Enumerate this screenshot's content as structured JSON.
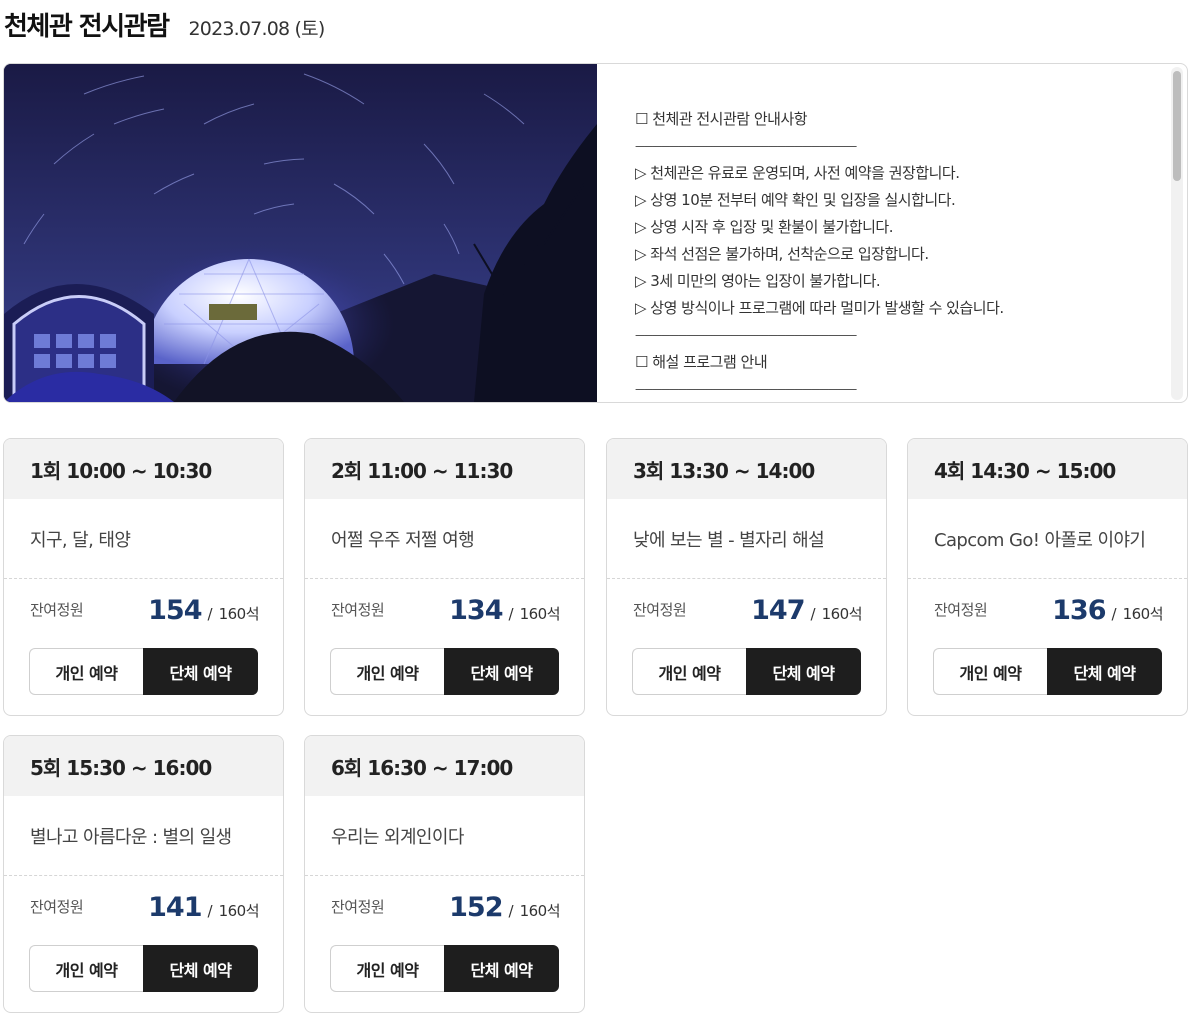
{
  "header": {
    "title": "천체관 전시관람",
    "date": "2023.07.08 (토)"
  },
  "hero": {
    "photo_alt": "천체관",
    "notice_lines": [
      "☐ 천체관 전시관람 안내사항",
      "------------------------------------------------------------------------------",
      "▷ 천체관은 유료로 운영되며, 사전 예약을 권장합니다.",
      "▷ 상영 10분 전부터 예약 확인 및 입장을 실시합니다.",
      "▷ 상영 시작 후 입장 및 환불이 불가합니다.",
      "▷ 좌석 선점은 불가하며, 선착순으로 입장합니다.",
      "▷ 3세 미만의 영아는 입장이 불가합니다.",
      "▷ 상영 방식이나 프로그램에 따라 멀미가 발생할 수 있습니다.",
      "------------------------------------------------------------------------------",
      "☐ 해설 프로그램 안내",
      "------------------------------------------------------------------------------"
    ]
  },
  "sessions": [
    {
      "title": "1회 10:00 ~ 10:30",
      "program": "지구, 달, 태양",
      "seats_label": "잔여정원",
      "remaining": "154",
      "slash": "/",
      "total": "160석",
      "individual_label": "개인 예약",
      "group_label": "단체 예약"
    },
    {
      "title": "2회 11:00 ~ 11:30",
      "program": "어쩔 우주 저쩔 여행",
      "seats_label": "잔여정원",
      "remaining": "134",
      "slash": "/",
      "total": "160석",
      "individual_label": "개인 예약",
      "group_label": "단체 예약"
    },
    {
      "title": "3회 13:30 ~ 14:00",
      "program": "낮에 보는 별 - 별자리 해설",
      "seats_label": "잔여정원",
      "remaining": "147",
      "slash": "/",
      "total": "160석",
      "individual_label": "개인 예약",
      "group_label": "단체 예약"
    },
    {
      "title": "4회 14:30 ~ 15:00",
      "program": "Capcom Go! 아폴로 이야기",
      "seats_label": "잔여정원",
      "remaining": "136",
      "slash": "/",
      "total": "160석",
      "individual_label": "개인 예약",
      "group_label": "단체 예약"
    },
    {
      "title": "5회 15:30 ~ 16:00",
      "program": "별나고 아름다운 : 별의 일생",
      "seats_label": "잔여정원",
      "remaining": "141",
      "slash": "/",
      "total": "160석",
      "individual_label": "개인 예약",
      "group_label": "단체 예약"
    },
    {
      "title": "6회 16:30 ~ 17:00",
      "program": "우리는 외계인이다",
      "seats_label": "잔여정원",
      "remaining": "152",
      "slash": "/",
      "total": "160석",
      "individual_label": "개인 예약",
      "group_label": "단체 예약"
    }
  ],
  "colors": {
    "accent_number": "#1c3a6b",
    "group_button_bg": "#1e1e1e",
    "card_header_bg": "#f2f2f2"
  }
}
